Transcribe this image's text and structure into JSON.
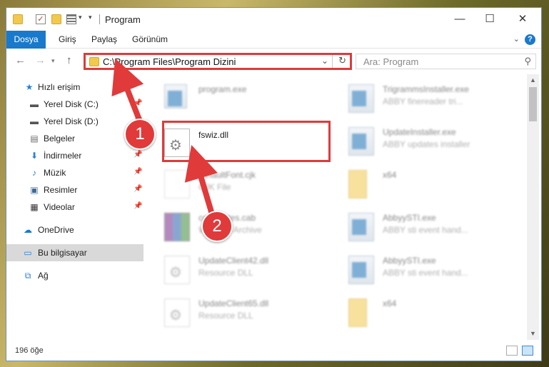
{
  "window": {
    "title": "Program",
    "controls": {
      "minimize": "—",
      "maximize": "☐",
      "close": "✕"
    }
  },
  "ribbon": {
    "tabs": [
      "Dosya",
      "Giriş",
      "Paylaş",
      "Görünüm"
    ],
    "help": "?"
  },
  "navigation": {
    "address": "C:\\Program Files\\Program Dizini",
    "search_placeholder": "Ara: Program"
  },
  "sidebar": {
    "items": [
      {
        "label": "Hızlı erişim",
        "icon": "star-icon",
        "pinned": false
      },
      {
        "label": "Yerel Disk (C:)",
        "icon": "drive-icon",
        "pinned": true
      },
      {
        "label": "Yerel Disk (D:)",
        "icon": "drive-icon",
        "pinned": true
      },
      {
        "label": "Belgeler",
        "icon": "documents-icon",
        "pinned": true
      },
      {
        "label": "İndirmeler",
        "icon": "download-icon",
        "pinned": true
      },
      {
        "label": "Müzik",
        "icon": "music-icon",
        "pinned": true
      },
      {
        "label": "Resimler",
        "icon": "pictures-icon",
        "pinned": true
      },
      {
        "label": "Videolar",
        "icon": "videos-icon",
        "pinned": true
      },
      {
        "label": "OneDrive",
        "icon": "cloud-icon",
        "pinned": false
      },
      {
        "label": "Bu bilgisayar",
        "icon": "computer-icon",
        "pinned": false,
        "selected": true
      },
      {
        "label": "Ağ",
        "icon": "network-icon",
        "pinned": false
      }
    ]
  },
  "files": {
    "left": [
      {
        "name": "program.exe",
        "type": ""
      },
      {
        "name": "fswiz.dll",
        "type": ""
      },
      {
        "name": "DefaultFont.cjk",
        "type": "CJK File"
      },
      {
        "name": "certificates.cab",
        "type": "WinRAR Archive"
      },
      {
        "name": "UpdateClient42.dll",
        "type": "Resource DLL"
      },
      {
        "name": "UpdateClient65.dll",
        "type": "Resource DLL"
      }
    ],
    "right": [
      {
        "name": "TrigrammsInstaller.exe",
        "type": "ABBY finereader tri..."
      },
      {
        "name": "UpdateInstaller.exe",
        "type": "ABBY updates installer"
      },
      {
        "name": "x64",
        "type": ""
      },
      {
        "name": "AbbyySTI.exe",
        "type": "ABBY sti event hand..."
      },
      {
        "name": "AbbyySTI.exe",
        "type": "ABBY sti event hand..."
      },
      {
        "name": "x64",
        "type": ""
      }
    ]
  },
  "status": {
    "count": "196 öğe"
  },
  "annotations": {
    "step1": "1",
    "step2": "2"
  },
  "colors": {
    "accent": "#1979ca",
    "annotation": "#e03a3a"
  }
}
